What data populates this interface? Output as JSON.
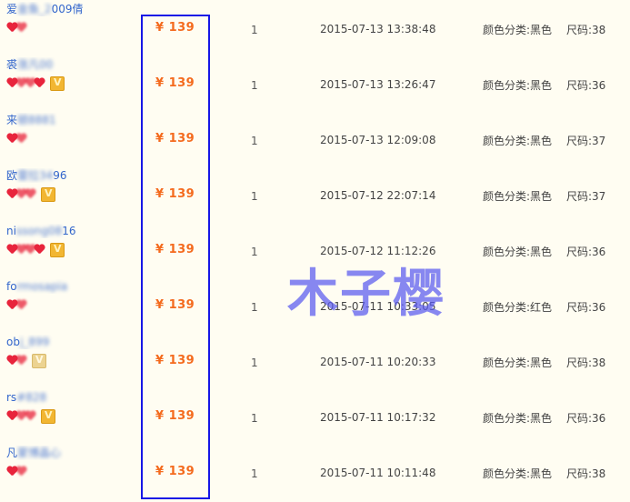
{
  "currency_symbol": "¥",
  "rows": [
    {
      "buyer_visible": "爱",
      "buyer_blur": "金鱼_2",
      "buyer_tail": "009倩",
      "price": "139",
      "qty": "1",
      "time": "2015-07-13 13:38:48",
      "sku": "颜色分类:黑色",
      "size": "尺码:38"
    },
    {
      "buyer_visible": "裘",
      "buyer_blur": "涨凡00",
      "buyer_tail": "",
      "price": "139",
      "qty": "1",
      "time": "2015-07-13 13:26:47",
      "sku": "颜色分类:黑色",
      "size": "尺码:36"
    },
    {
      "buyer_visible": "来",
      "buyer_blur": "顿8881",
      "buyer_tail": "",
      "price": "139",
      "qty": "1",
      "time": "2015-07-13 12:09:08",
      "sku": "颜色分类:黑色",
      "size": "尺码:37"
    },
    {
      "buyer_visible": "欧",
      "buyer_blur": "雷拉34",
      "buyer_tail": "96",
      "price": "139",
      "qty": "1",
      "time": "2015-07-12 22:07:14",
      "sku": "颜色分类:黑色",
      "size": "尺码:37"
    },
    {
      "buyer_visible": "ni",
      "buyer_blur": "ssong08",
      "buyer_tail": "16",
      "price": "139",
      "qty": "1",
      "time": "2015-07-12 11:12:26",
      "sku": "颜色分类:黑色",
      "size": "尺码:36"
    },
    {
      "buyer_visible": "fo",
      "buyer_blur": "rmosapia",
      "buyer_tail": "",
      "price": "139",
      "qty": "1",
      "time": "2015-07-11 10:33:05",
      "sku": "颜色分类:红色",
      "size": "尺码:36"
    },
    {
      "buyer_visible": "ob",
      "buyer_blur": "j_899",
      "buyer_tail": "",
      "price": "139",
      "qty": "1",
      "time": "2015-07-11 10:20:33",
      "sku": "颜色分类:黑色",
      "size": "尺码:38"
    },
    {
      "buyer_visible": "rs",
      "buyer_blur": "#828",
      "buyer_tail": "",
      "price": "139",
      "qty": "1",
      "time": "2015-07-11 10:17:32",
      "sku": "颜色分类:黑色",
      "size": "尺码:36"
    },
    {
      "buyer_visible": "凡",
      "buyer_blur": "蒙博晶心",
      "buyer_tail": "",
      "price": "139",
      "qty": "1",
      "time": "2015-07-11 10:11:48",
      "sku": "颜色分类:黑色",
      "size": "尺码:38"
    }
  ],
  "watermark": "木子樱",
  "colors": {
    "price": "#f46b1e",
    "highlight_border": "#1717e6",
    "buyer_link": "#3366cc",
    "heart": "#e8243c",
    "watermark": "#5a5af0"
  }
}
